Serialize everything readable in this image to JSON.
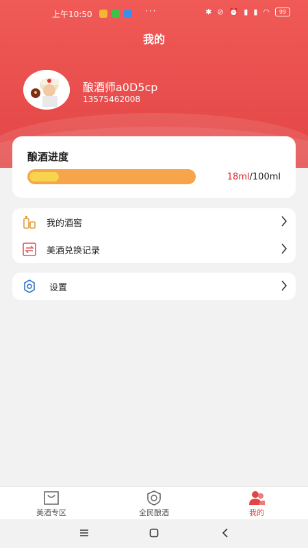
{
  "status_bar": {
    "time": "上午10:50",
    "more": "···",
    "battery": "99"
  },
  "header": {
    "title": "我的"
  },
  "profile": {
    "username": "酿酒师a0D5cp",
    "phone": "13575462008"
  },
  "progress": {
    "title": "酿酒进度",
    "current": "18ml",
    "separator": "/",
    "total": "100ml",
    "fraction": 0.18
  },
  "menu": {
    "items": [
      {
        "label": "我的酒窖",
        "icon": "wine-cellar-icon"
      },
      {
        "label": "美酒兑换记录",
        "icon": "exchange-icon"
      }
    ]
  },
  "settings": {
    "label": "设置",
    "icon": "gear-icon"
  },
  "tabs": [
    {
      "label": "美酒专区",
      "icon": "bag-icon",
      "active": false
    },
    {
      "label": "全民酿酒",
      "icon": "shield-icon",
      "active": false
    },
    {
      "label": "我的",
      "icon": "users-icon",
      "active": true
    }
  ],
  "colors": {
    "brand": "#e24545",
    "progress_track": "#f6a54a",
    "progress_fill": "#f8d34d"
  }
}
